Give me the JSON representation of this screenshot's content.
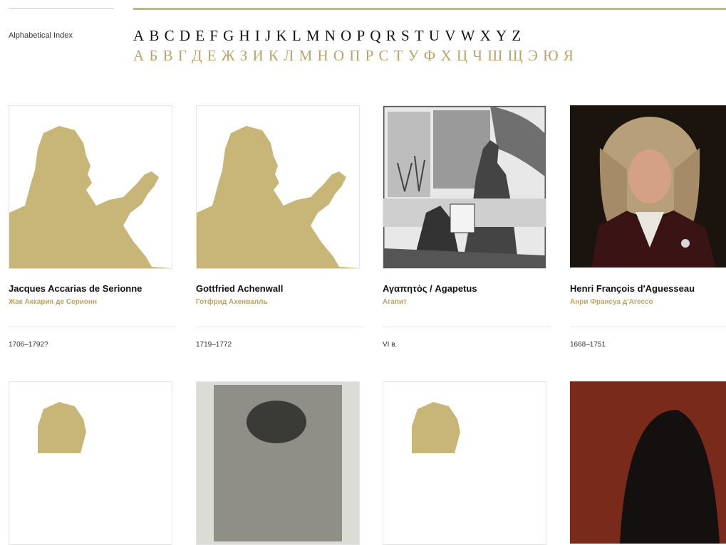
{
  "index_label": "Alphabetical Index",
  "alphabet_latin": [
    "A",
    "B",
    "C",
    "D",
    "E",
    "F",
    "G",
    "H",
    "I",
    "J",
    "K",
    "L",
    "M",
    "N",
    "O",
    "P",
    "Q",
    "R",
    "S",
    "T",
    "U",
    "V",
    "W",
    "X",
    "Y",
    "Z"
  ],
  "alphabet_cyrillic": [
    "А",
    "Б",
    "В",
    "Г",
    "Д",
    "Е",
    "Ж",
    "З",
    "И",
    "К",
    "Л",
    "М",
    "Н",
    "О",
    "П",
    "Р",
    "С",
    "Т",
    "У",
    "Ф",
    "Х",
    "Ц",
    "Ч",
    "Ш",
    "Щ",
    "Э",
    "Ю",
    "Я"
  ],
  "colors": {
    "gold": "#c8b679",
    "gold_text": "#b8a36a"
  },
  "persons": [
    {
      "name": "Jacques Accarias de Serionne",
      "name_ru": "Жак Аккария де Серионн",
      "dates": "1706–1792?",
      "image": "silhouette"
    },
    {
      "name": "Gottfried Achenwall",
      "name_ru": "Готфрид Ахенвалль",
      "dates": "1719–1772",
      "image": "silhouette"
    },
    {
      "name": "Αγαπητὸς / Agapetus",
      "name_ru": "Агапит",
      "dates": "VI в.",
      "image": "engraving"
    },
    {
      "name": "Henri François d'Aguesseau",
      "name_ru": "Анри Франсуа д'Агессо",
      "dates": "1668–1751",
      "image": "portrait"
    }
  ],
  "second_row_images": [
    "silhouette",
    "engraving-portrait",
    "silhouette",
    "painting-portrait"
  ]
}
